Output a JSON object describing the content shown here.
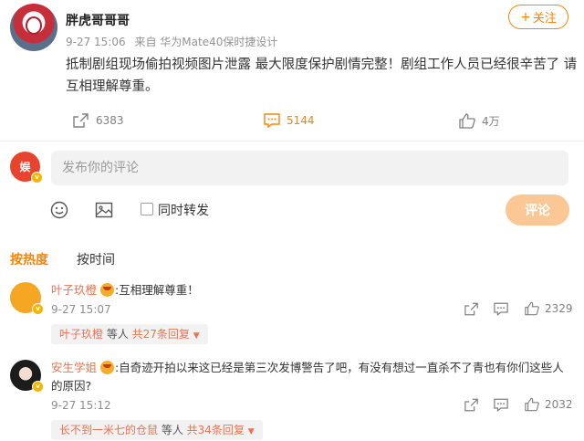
{
  "post": {
    "author": "胖虎哥哥哥",
    "follow_label": "关注",
    "time": "9-27 15:06",
    "source": "来自 华为Mate40保时捷设计",
    "text": "抵制剧组现场偷拍视频图片泄露 最大限度保护剧情完整！剧组工作人员已经很辛苦了 请互相理解尊重。",
    "reposts": "6383",
    "comments": "5144",
    "likes": "4万"
  },
  "composer": {
    "avatar_text": "娱",
    "placeholder": "发布你的评论",
    "forward_label": "同时转发",
    "submit_label": "评论",
    "icons": [
      "emoji-icon",
      "image-icon"
    ]
  },
  "sort_tabs": {
    "hot": "按热度",
    "time": "按时间"
  },
  "comments": [
    {
      "name": "叶子玖橙",
      "text": ":互相理解尊重！",
      "time": "9-27 15:07",
      "likes": "2329",
      "replies": {
        "name": "叶子玖橙",
        "suffix": " 等人 ",
        "count": "共27条回复"
      }
    },
    {
      "name": "安生学姐",
      "text": ":自奇迹开拍以来这已经是第三次发博警告了吧，有没有想过一直杀不了青也有你们这些人的原因?",
      "time": "9-27 15:12",
      "likes": "2032",
      "replies": {
        "name": "长不到一米七的仓鼠",
        "suffix": " 等人 ",
        "count": "共34条回复"
      }
    }
  ],
  "colors": {
    "accent": "#ff8200",
    "username": "#eb7350",
    "submit_disabled": "#fbc895"
  }
}
